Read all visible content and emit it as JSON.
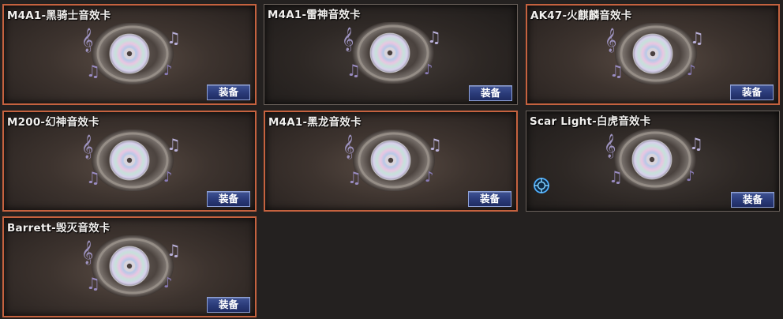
{
  "cards": [
    {
      "title": "M4A1-黑骑士音效卡",
      "button": "装备",
      "selected": true
    },
    {
      "title": "M4A1-雷神音效卡",
      "button": "装备",
      "selected": false
    },
    {
      "title": "AK47-火麒麟音效卡",
      "button": "装备",
      "selected": true
    },
    {
      "title": "M200-幻神音效卡",
      "button": "装备",
      "selected": true
    },
    {
      "title": "M4A1-黑龙音效卡",
      "button": "装备",
      "selected": true
    },
    {
      "title": "Scar Light-白虎音效卡",
      "button": "装备",
      "selected": false
    },
    {
      "title": "Barrett-毁灭音效卡",
      "button": "装备",
      "selected": true
    }
  ],
  "icons": {
    "card_art": "music-disc-icon",
    "badge": "target-icon"
  },
  "colors": {
    "selected_border": "#c5623f",
    "button_bg": "#2a3a78"
  }
}
